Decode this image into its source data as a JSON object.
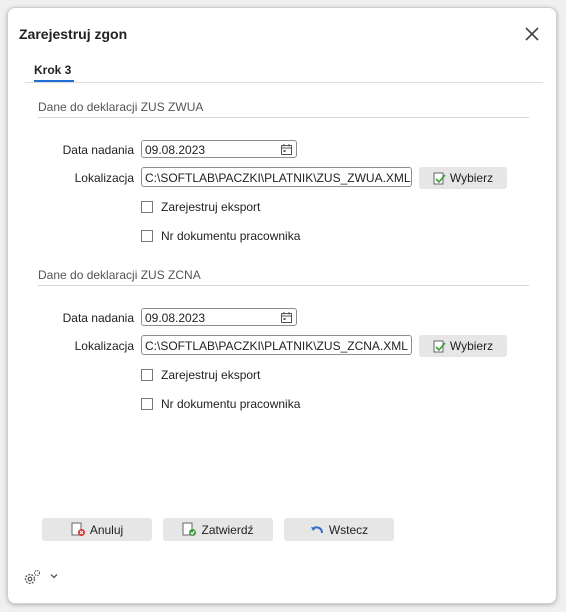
{
  "dialog": {
    "title": "Zarejestruj zgon",
    "tab_label": "Krok 3"
  },
  "sections": [
    {
      "title": "Dane do deklaracji ZUS ZWUA",
      "date_label": "Data nadania",
      "date_value": "09.08.2023",
      "location_label": "Lokalizacja",
      "location_value": "C:\\SOFTLAB\\PACZKI\\PLATNIK\\ZUS_ZWUA.XML",
      "choose_label": "Wybierz",
      "register_export_label": "Zarejestruj eksport",
      "employee_doc_label": "Nr dokumentu pracownika"
    },
    {
      "title": "Dane do deklaracji ZUS ZCNA",
      "date_label": "Data nadania",
      "date_value": "09.08.2023",
      "location_label": "Lokalizacja",
      "location_value": "C:\\SOFTLAB\\PACZKI\\PLATNIK\\ZUS_ZCNA.XML",
      "choose_label": "Wybierz",
      "register_export_label": "Zarejestruj eksport",
      "employee_doc_label": "Nr dokumentu pracownika"
    }
  ],
  "footer": {
    "cancel_label": "Anuluj",
    "confirm_label": "Zatwierdź",
    "back_label": "Wstecz"
  },
  "icons": {
    "close": "close-icon",
    "calendar": "calendar-icon",
    "choose": "folder-pick-icon",
    "cancel": "cancel-doc-icon",
    "confirm": "confirm-doc-icon",
    "back": "back-arrow-icon",
    "settings": "gear-icon",
    "expand": "chevron-down-icon"
  }
}
